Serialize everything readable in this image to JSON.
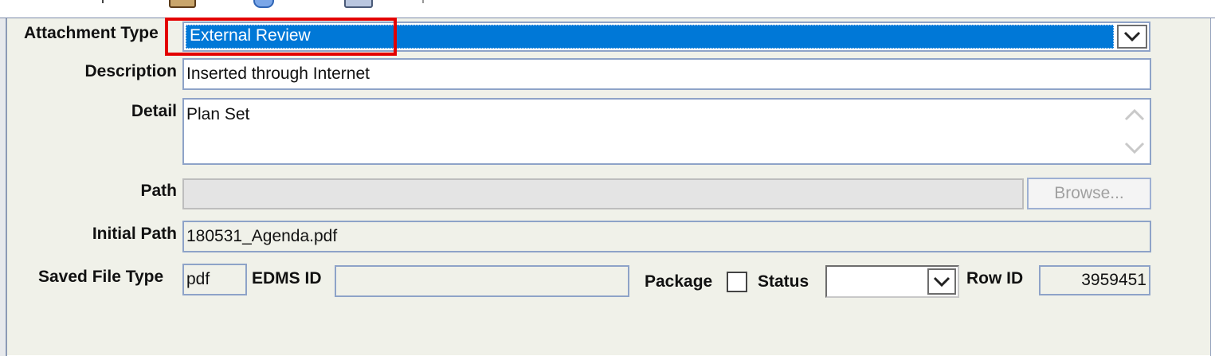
{
  "form": {
    "attachment_type": {
      "label": "Attachment Type",
      "value": "External Review"
    },
    "description": {
      "label": "Description",
      "value": "Inserted through Internet"
    },
    "detail": {
      "label": "Detail",
      "value": "Plan Set"
    },
    "path": {
      "label": "Path",
      "value": "",
      "browse_label": "Browse..."
    },
    "initial_path": {
      "label": "Initial Path",
      "value": "180531_Agenda.pdf"
    },
    "saved_file_type": {
      "label": "Saved File Type",
      "value": "pdf"
    },
    "edms_id": {
      "label": "EDMS ID",
      "value": ""
    },
    "package": {
      "label": "Package",
      "checked": false
    },
    "status": {
      "label": "Status",
      "value": ""
    },
    "row_id": {
      "label": "Row ID",
      "value": "3959451"
    }
  },
  "icons": {
    "dropdown": "chevron-down-icon",
    "scroll_up": "chevron-up-icon",
    "scroll_down": "chevron-down-icon"
  },
  "colors": {
    "selection_bg": "#0078d7",
    "highlight": "#e30000",
    "panel_bg": "#f0f1e9",
    "field_border": "#8ea3c8"
  }
}
